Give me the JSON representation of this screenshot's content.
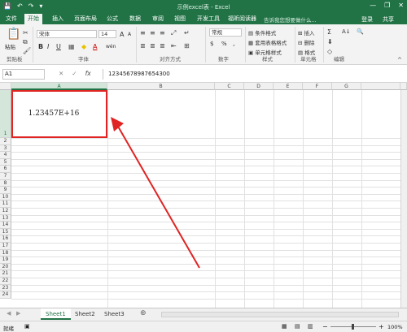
{
  "window": {
    "title": "示例excel表 - Excel",
    "minimize": "—",
    "restore": "❐",
    "close": "✕"
  },
  "qat": {
    "save": "💾",
    "undo": "↶",
    "redo": "↷",
    "more": "▾"
  },
  "ribbon_tabs": [
    "文件",
    "开始",
    "插入",
    "页面布局",
    "公式",
    "数据",
    "审阅",
    "视图",
    "开发工具",
    "福昕阅读器"
  ],
  "active_tab": "开始",
  "tell_me": "告诉我您想要做什么...",
  "login": "登录",
  "share": "共享",
  "ribbon": {
    "clipboard": {
      "label": "剪贴板",
      "paste": "粘贴"
    },
    "font": {
      "label": "字体",
      "name": "宋体",
      "size": "14",
      "bold": "B",
      "italic": "I",
      "underline": "U",
      "grow": "A",
      "shrink": "A",
      "font_color": "A",
      "fill": "◆",
      "border": "▦",
      "wen": "wén"
    },
    "alignment": {
      "label": "对齐方式"
    },
    "number": {
      "label": "数字",
      "format": "常规",
      "percent": "%",
      "comma": ",",
      "currency": "$"
    },
    "styles": {
      "label": "样式",
      "conditional": "条件格式",
      "table": "套用表格格式",
      "cell_styles": "单元格样式"
    },
    "cells": {
      "label": "单元格",
      "insert": "插入",
      "delete": "删除",
      "format": "格式"
    },
    "editing": {
      "label": "编辑",
      "sum": "Σ",
      "sort": "A↓",
      "find": "🔍"
    }
  },
  "formula_bar": {
    "name_box": "A1",
    "cancel": "✕",
    "enter": "✓",
    "fx": "fx",
    "content": "12345678987654300"
  },
  "columns": [
    "A",
    "B",
    "C",
    "D",
    "E",
    "F",
    "G"
  ],
  "rows": [
    "1",
    "2",
    "3",
    "4",
    "5",
    "6",
    "7",
    "8",
    "9",
    "10",
    "11",
    "12",
    "13",
    "14",
    "15",
    "16",
    "17",
    "18",
    "19",
    "20",
    "21",
    "22",
    "23",
    "24"
  ],
  "cell_a1": "1.23457E+16",
  "sheets": [
    "Sheet1",
    "Sheet2",
    "Sheet3"
  ],
  "active_sheet": "Sheet1",
  "add_sheet": "⊕",
  "status": {
    "ready": "就绪",
    "zoom": "100%",
    "zoom_minus": "−",
    "zoom_plus": "+"
  },
  "colors": {
    "brand": "#217346",
    "highlight": "#e02424"
  }
}
